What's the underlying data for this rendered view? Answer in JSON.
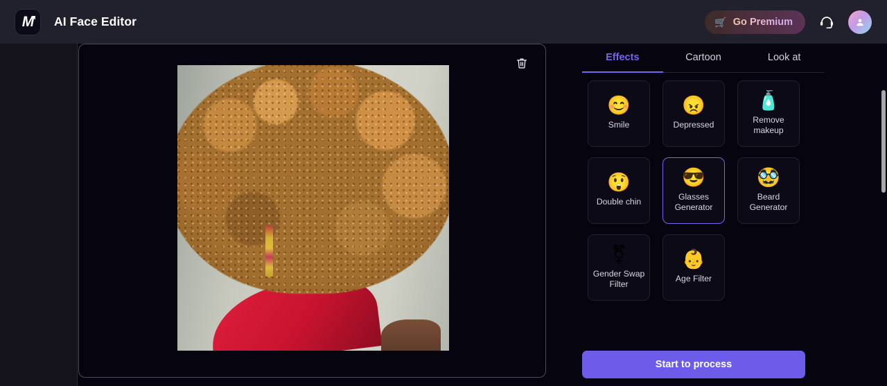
{
  "header": {
    "logo_icon": "m-logo-icon",
    "logo_glyph": "M",
    "title": "AI Face Editor",
    "premium_button": {
      "label": "Go Premium",
      "icon": "shopping-cart-icon"
    },
    "support_icon": "headset-support-icon",
    "avatar_icon": "user-avatar-icon"
  },
  "workspace": {
    "delete_icon": "trash-icon",
    "photo_alt": "portrait-photo"
  },
  "panel": {
    "tabs": [
      {
        "label": "Effects",
        "active": true
      },
      {
        "label": "Cartoon",
        "active": false
      },
      {
        "label": "Look at",
        "active": false
      }
    ],
    "effects": [
      {
        "label": "Smile",
        "emoji": "😊",
        "icon": "smiling-face-icon",
        "selected": false
      },
      {
        "label": "Depressed",
        "emoji": "😠",
        "icon": "angry-face-icon",
        "selected": false
      },
      {
        "label": "Remove makeup",
        "emoji": "🧴",
        "icon": "lotion-bottle-icon",
        "selected": false
      },
      {
        "label": "Double chin",
        "emoji": "😲",
        "icon": "astonished-face-icon",
        "selected": false
      },
      {
        "label": "Glasses Generator",
        "emoji": "😎",
        "icon": "sunglasses-face-icon",
        "selected": true
      },
      {
        "label": "Beard Generator",
        "emoji": "🥸",
        "icon": "mustache-face-icon",
        "selected": false
      },
      {
        "label": "Gender Swap Filter",
        "emoji": "⚧",
        "icon": "gender-symbols-icon",
        "selected": false
      },
      {
        "label": "Age Filter",
        "emoji": "👶",
        "icon": "baby-face-icon",
        "selected": false
      }
    ],
    "process_button_label": "Start to process"
  },
  "colors": {
    "accent_purple": "#7b62f0",
    "process_button": "#6c5ce9",
    "header_bg": "#21212e",
    "page_bg": "#05040f"
  }
}
